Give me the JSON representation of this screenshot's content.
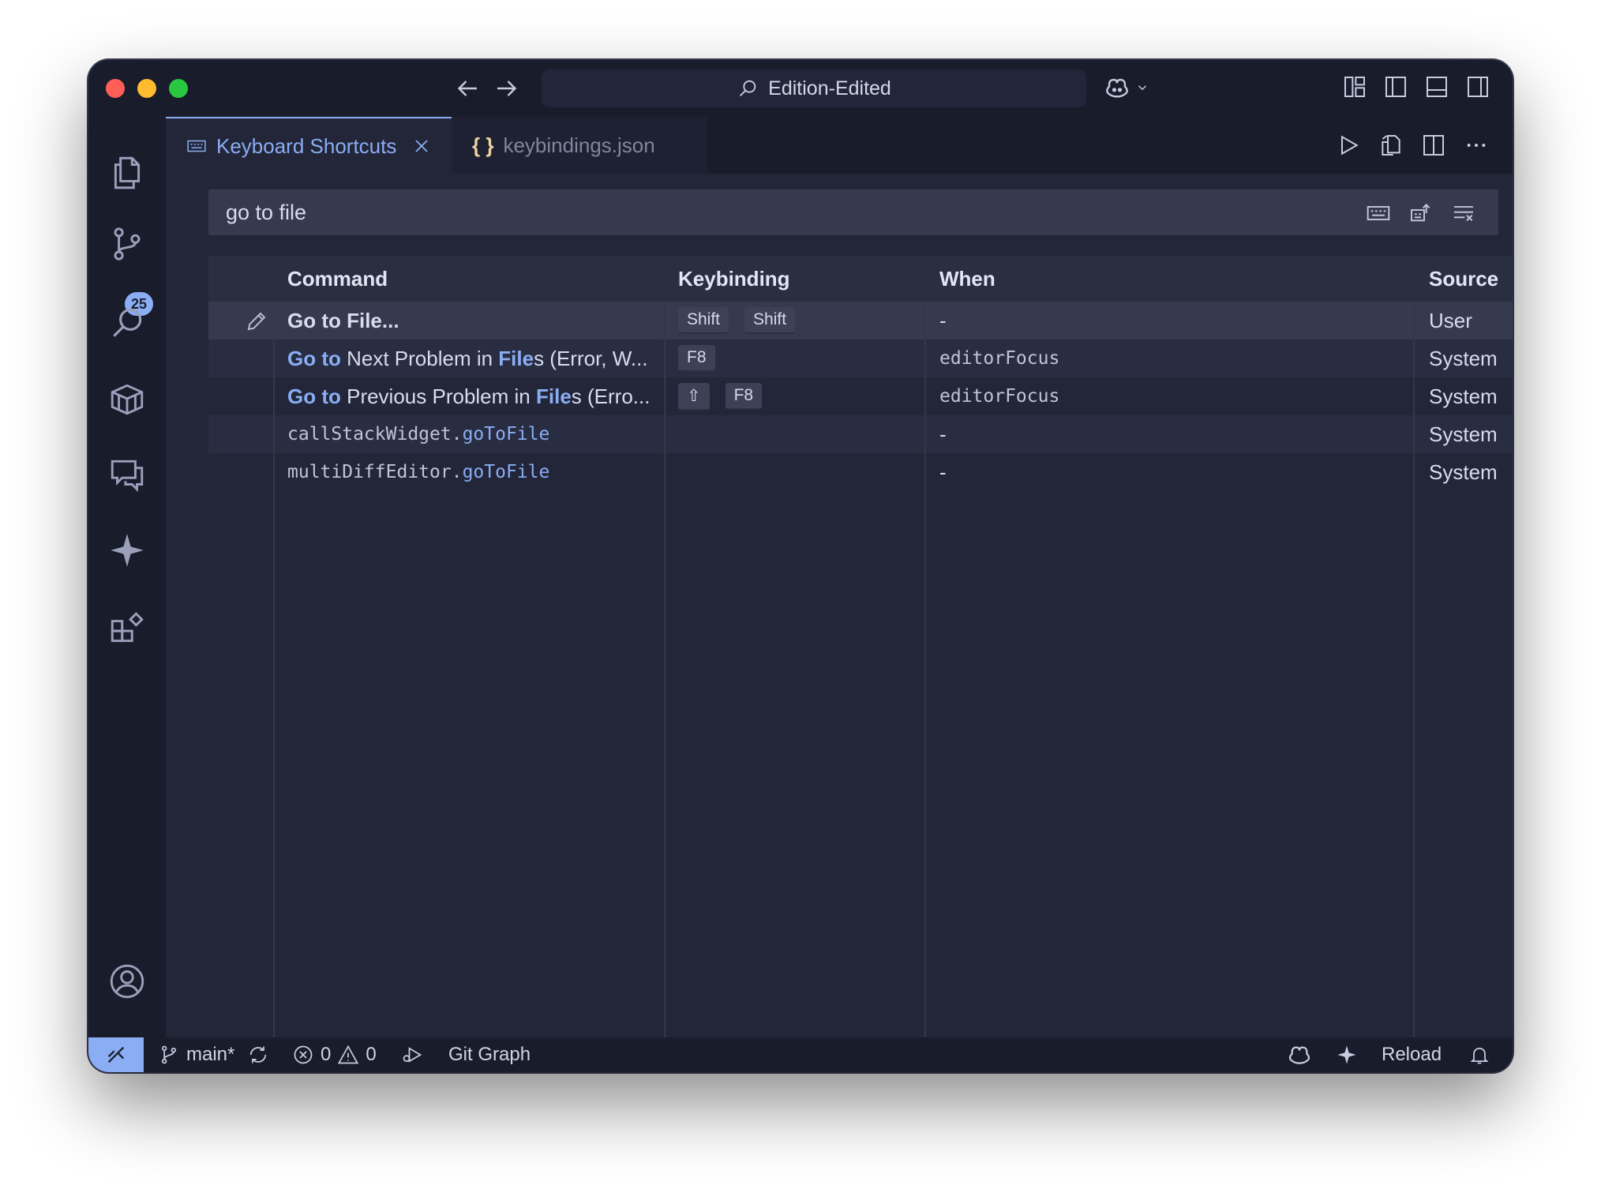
{
  "titlebar": {
    "title": "Edition-Edited"
  },
  "activity_bar": {
    "scm_badge": "25"
  },
  "tabs": [
    {
      "label": "Keyboard Shortcuts",
      "icon": "keyboard-icon",
      "active": true
    },
    {
      "label": "keybindings.json",
      "icon": "json-braces-icon",
      "active": false
    }
  ],
  "search": {
    "value": "go to file"
  },
  "table": {
    "headers": {
      "command": "Command",
      "keybinding": "Keybinding",
      "when": "When",
      "source": "Source"
    },
    "rows": [
      {
        "command_parts": [
          {
            "t": "Go to File...",
            "hl": false
          }
        ],
        "keys": [
          "Shift",
          "Shift"
        ],
        "when": "-",
        "source": "User"
      },
      {
        "command_parts": [
          {
            "t": "Go to",
            "hl": true
          },
          {
            "t": " Next Problem in ",
            "hl": false
          },
          {
            "t": "File",
            "hl": true
          },
          {
            "t": "s (Error, W...",
            "hl": false
          }
        ],
        "keys": [
          "F8"
        ],
        "when": "editorFocus",
        "source": "System"
      },
      {
        "command_parts": [
          {
            "t": "Go to",
            "hl": true
          },
          {
            "t": " Previous Problem in ",
            "hl": false
          },
          {
            "t": "File",
            "hl": true
          },
          {
            "t": "s (Erro...",
            "hl": false
          }
        ],
        "keys": [
          "⇧",
          "F8"
        ],
        "when": "editorFocus",
        "source": "System"
      },
      {
        "command_parts": [
          {
            "t": "callStackWidget.",
            "hl": false
          },
          {
            "t": "goToFile",
            "hl": true
          }
        ],
        "keys": [],
        "when": "-",
        "source": "System"
      },
      {
        "command_parts": [
          {
            "t": "multiDiffEditor.",
            "hl": false
          },
          {
            "t": "goToFile",
            "hl": true
          }
        ],
        "keys": [],
        "when": "-",
        "source": "System"
      }
    ]
  },
  "statusbar": {
    "branch": "main*",
    "errors": "0",
    "warnings": "0",
    "git_graph": "Git Graph",
    "reload": "Reload"
  },
  "colors": {
    "accent": "#8aadf4",
    "background": "#222638",
    "chrome": "#191c2a"
  }
}
